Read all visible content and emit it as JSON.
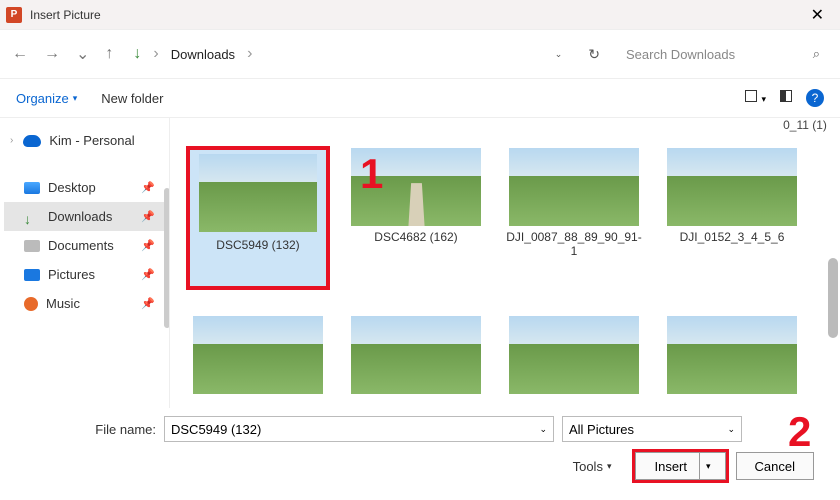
{
  "title": "Insert Picture",
  "breadcrumb": {
    "current": "Downloads"
  },
  "search": {
    "placeholder": "Search Downloads"
  },
  "toolbar": {
    "organize": "Organize",
    "newfolder": "New folder"
  },
  "sidebar": {
    "account": "Kim - Personal",
    "items": [
      {
        "label": "Desktop"
      },
      {
        "label": "Downloads"
      },
      {
        "label": "Documents"
      },
      {
        "label": "Pictures"
      },
      {
        "label": "Music"
      }
    ]
  },
  "partial_row_label": "0_11 (1)",
  "files": [
    {
      "name": "DSC5949 (132)",
      "selected": true
    },
    {
      "name": "DSC4682 (162)"
    },
    {
      "name": "DJI_0087_88_89_90_91-1"
    },
    {
      "name": "DJI_0152_3_4_5_6"
    }
  ],
  "footer": {
    "filename_label": "File name:",
    "filename_value": "DSC5949 (132)",
    "filter": "All Pictures",
    "tools": "Tools",
    "insert": "Insert",
    "cancel": "Cancel"
  },
  "annotations": {
    "one": "1",
    "two": "2"
  }
}
